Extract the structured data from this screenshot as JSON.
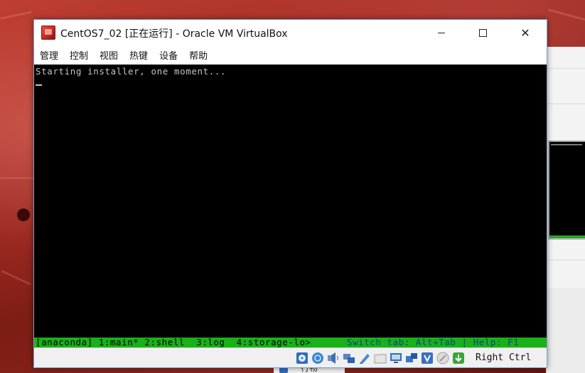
{
  "window": {
    "title": "CentOS7_02 [正在运行] - Oracle VM VirtualBox",
    "minimize_glyph": "",
    "close_glyph": "✕"
  },
  "menu": [
    "管理",
    "控制",
    "视图",
    "热键",
    "设备",
    "帮助"
  ],
  "console": {
    "line1": "Starting installer, one moment...",
    "tmux_left": "[anaconda] 1:main* 2:shell  3:log  4:storage-lo>",
    "tmux_right": "Switch tab: Alt+Tab | Help: F1"
  },
  "statusbar": {
    "icons": [
      "optical-drive-icon",
      "network-globe-icon",
      "audio-icon",
      "network-adapter-icon",
      "usb-icon",
      "shared-folder-icon",
      "display-icon",
      "video-capture-icon",
      "vt-x-icon",
      "mouse-integration-icon",
      "host-key-icon"
    ],
    "host_key": "Right Ctrl"
  },
  "background": {
    "peek_label": "行物"
  },
  "colors": {
    "console_bg": "#000000",
    "console_fg": "#c4c4c4",
    "tmux_bar": "#18b218",
    "tmux_highlight": "#0b3f8c"
  }
}
